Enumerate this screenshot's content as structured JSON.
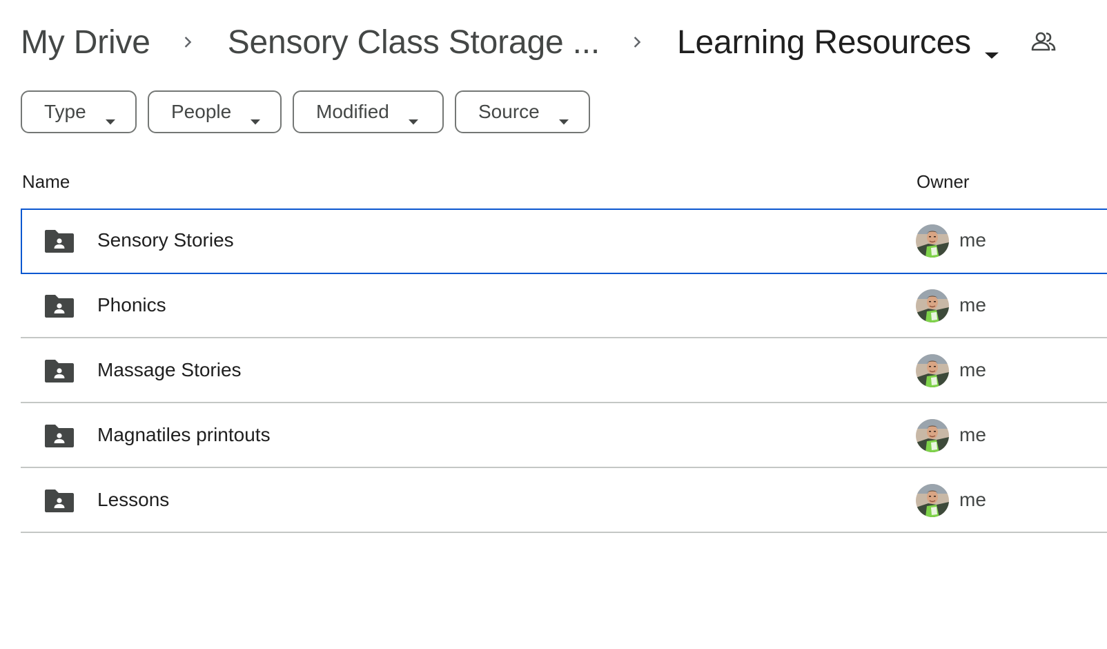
{
  "breadcrumb": {
    "items": [
      {
        "label": "My Drive"
      },
      {
        "label": "Sensory Class Storage ..."
      },
      {
        "label": "Learning Resources"
      }
    ],
    "current_icon": "caret-down-icon",
    "share_icon": "people-icon"
  },
  "filters": [
    {
      "label": "Type"
    },
    {
      "label": "People"
    },
    {
      "label": "Modified"
    },
    {
      "label": "Source"
    }
  ],
  "table": {
    "columns": {
      "name": "Name",
      "owner": "Owner"
    },
    "rows": [
      {
        "name": "Sensory Stories",
        "owner": "me",
        "icon": "shared-folder-icon",
        "selected": true
      },
      {
        "name": "Phonics",
        "owner": "me",
        "icon": "shared-folder-icon",
        "selected": false
      },
      {
        "name": "Massage Stories",
        "owner": "me",
        "icon": "shared-folder-icon",
        "selected": false
      },
      {
        "name": "Magnatiles printouts",
        "owner": "me",
        "icon": "shared-folder-icon",
        "selected": false
      },
      {
        "name": "Lessons",
        "owner": "me",
        "icon": "shared-folder-icon",
        "selected": false
      }
    ]
  },
  "colors": {
    "selection": "#0b57d0",
    "divider": "#c4c7c5",
    "text_primary": "#1f1f1f",
    "text_secondary": "#444746"
  }
}
